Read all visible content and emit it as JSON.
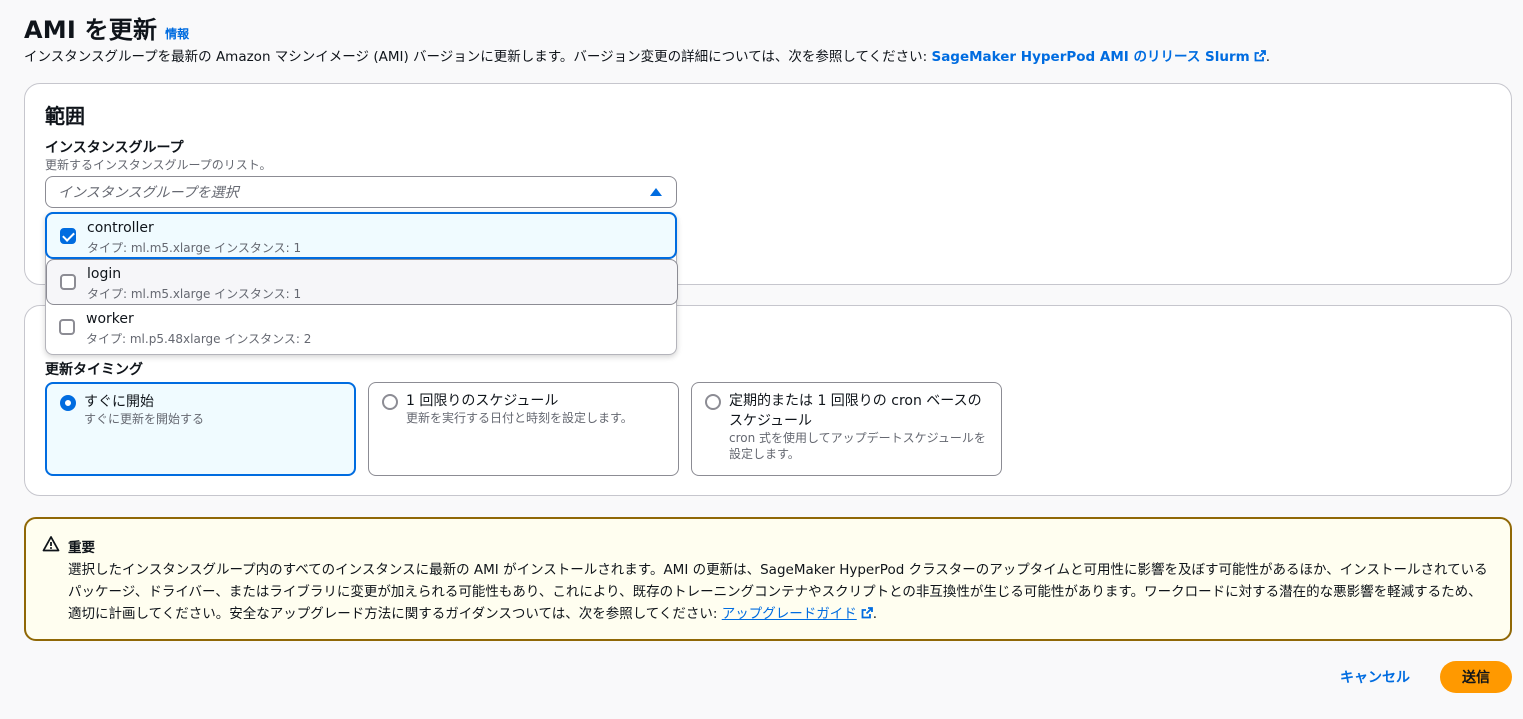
{
  "header": {
    "title": "AMI を更新",
    "info_link": "情報",
    "description_prefix": "インスタンスグループを最新の Amazon マシンイメージ (AMI) バージョンに更新します。バージョン変更の詳細については、次を参照してください: ",
    "description_link": "SageMaker HyperPod AMI のリリース Slurm",
    "description_suffix": "."
  },
  "scope": {
    "heading": "範囲",
    "field_label": "インスタンスグループ",
    "field_description": "更新するインスタンスグループのリスト。",
    "select_placeholder": "インスタンスグループを選択",
    "options": [
      {
        "name": "controller",
        "meta": "タイプ: ml.m5.xlarge インスタンス: 1",
        "checked": true
      },
      {
        "name": "login",
        "meta": "タイプ: ml.m5.xlarge インスタンス: 1",
        "checked": false
      },
      {
        "name": "worker",
        "meta": "タイプ: ml.p5.48xlarge インスタンス: 2",
        "checked": false
      }
    ]
  },
  "timing": {
    "field_label": "更新タイミング",
    "tiles": [
      {
        "title": "すぐに開始",
        "description": "すぐに更新を開始する",
        "selected": true
      },
      {
        "title": "1 回限りのスケジュール",
        "description": "更新を実行する日付と時刻を設定します。",
        "selected": false
      },
      {
        "title": "定期的または 1 回限りの cron ベースのスケジュール",
        "description": "cron 式を使用してアップデートスケジュールを設定します。",
        "selected": false
      }
    ]
  },
  "alert": {
    "title": "重要",
    "body": "選択したインスタンスグループ内のすべてのインスタンスに最新の AMI がインストールされます。AMI の更新は、SageMaker HyperPod クラスターのアップタイムと可用性に影響を及ぼす可能性があるほか、インストールされているパッケージ、ドライバー、またはライブラリに変更が加えられる可能性もあり、これにより、既存のトレーニングコンテナやスクリプトとの非互換性が生じる可能性があります。ワークロードに対する潜在的な悪影響を軽減するため、適切に計画してください。安全なアップグレード方法に関するガイダンスついては、次を参照してください: ",
    "link": "アップグレードガイド",
    "suffix": "."
  },
  "actions": {
    "cancel": "キャンセル",
    "submit": "送信"
  },
  "colors": {
    "accent": "#006ce0",
    "primary_button": "#ff9900",
    "warning_border": "#906806"
  }
}
